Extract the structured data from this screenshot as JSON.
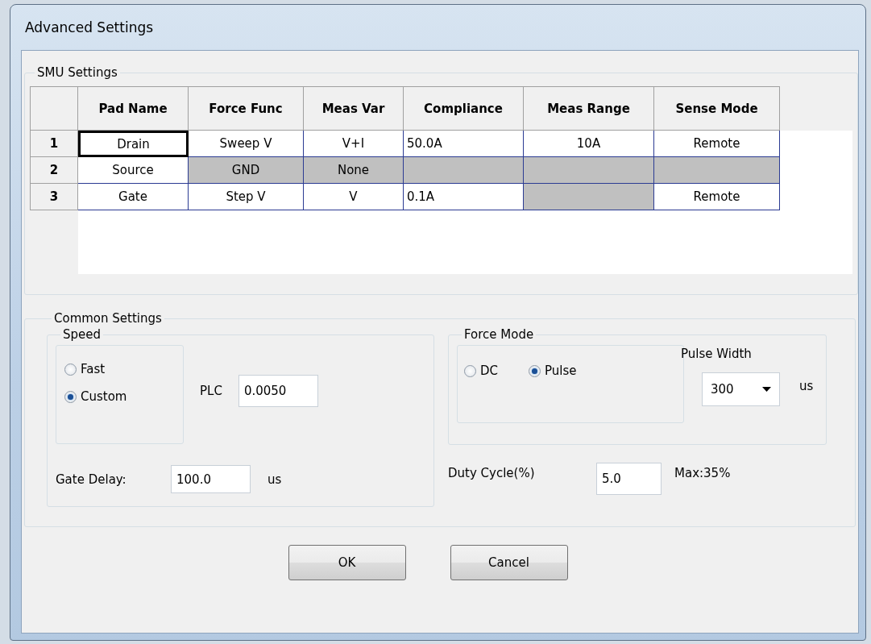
{
  "window": {
    "title": "Advanced Settings"
  },
  "smu_settings": {
    "title": "SMU Settings",
    "columns": [
      "Pad Name",
      "Force Func",
      "Meas Var",
      "Compliance",
      "Meas Range",
      "Sense Mode"
    ],
    "rows": [
      {
        "number": "1",
        "cells": [
          {
            "text": "Drain",
            "disabled": false,
            "focused": true
          },
          {
            "text": "Sweep V",
            "disabled": false,
            "focused": false
          },
          {
            "text": "V+I",
            "disabled": false,
            "focused": false
          },
          {
            "text": "50.0A",
            "disabled": false,
            "focused": false
          },
          {
            "text": "10A",
            "disabled": false,
            "focused": false
          },
          {
            "text": "Remote",
            "disabled": false,
            "focused": false
          }
        ]
      },
      {
        "number": "2",
        "cells": [
          {
            "text": "Source",
            "disabled": false,
            "focused": false
          },
          {
            "text": "GND",
            "disabled": true,
            "focused": false
          },
          {
            "text": "None",
            "disabled": true,
            "focused": false
          },
          {
            "disabled": true,
            "focused": false
          },
          {
            "disabled": true,
            "focused": false
          },
          {
            "disabled": true,
            "focused": false
          }
        ]
      },
      {
        "number": "3",
        "cells": [
          {
            "text": "Gate",
            "disabled": false,
            "focused": false
          },
          {
            "text": "Step V",
            "disabled": false,
            "focused": false
          },
          {
            "text": "V",
            "disabled": false,
            "focused": false
          },
          {
            "text": "0.1A",
            "disabled": false,
            "focused": false
          },
          {
            "disabled": true,
            "focused": false
          },
          {
            "text": "Remote",
            "disabled": false,
            "focused": false
          }
        ]
      }
    ]
  },
  "common_settings": {
    "title": "Common Settings",
    "speed": {
      "title": "Speed",
      "options": [
        {
          "label": "Fast",
          "selected": false
        },
        {
          "label": "Custom",
          "selected": true
        }
      ],
      "plc": {
        "label": "PLC",
        "value": "0.0050"
      },
      "gate_delay": {
        "label": "Gate Delay:",
        "value": "100.0",
        "unit": "us"
      }
    },
    "force_mode": {
      "title": "Force Mode",
      "options": [
        {
          "label": "DC",
          "selected": false
        },
        {
          "label": "Pulse",
          "selected": true
        }
      ],
      "pulse_width": {
        "label": "Pulse Width",
        "value": "300",
        "unit": "us"
      }
    },
    "duty_cycle": {
      "label": "Duty Cycle(%)",
      "value": "5.0",
      "note": "Max:35%"
    }
  },
  "buttons": [
    "OK",
    "Cancel"
  ]
}
